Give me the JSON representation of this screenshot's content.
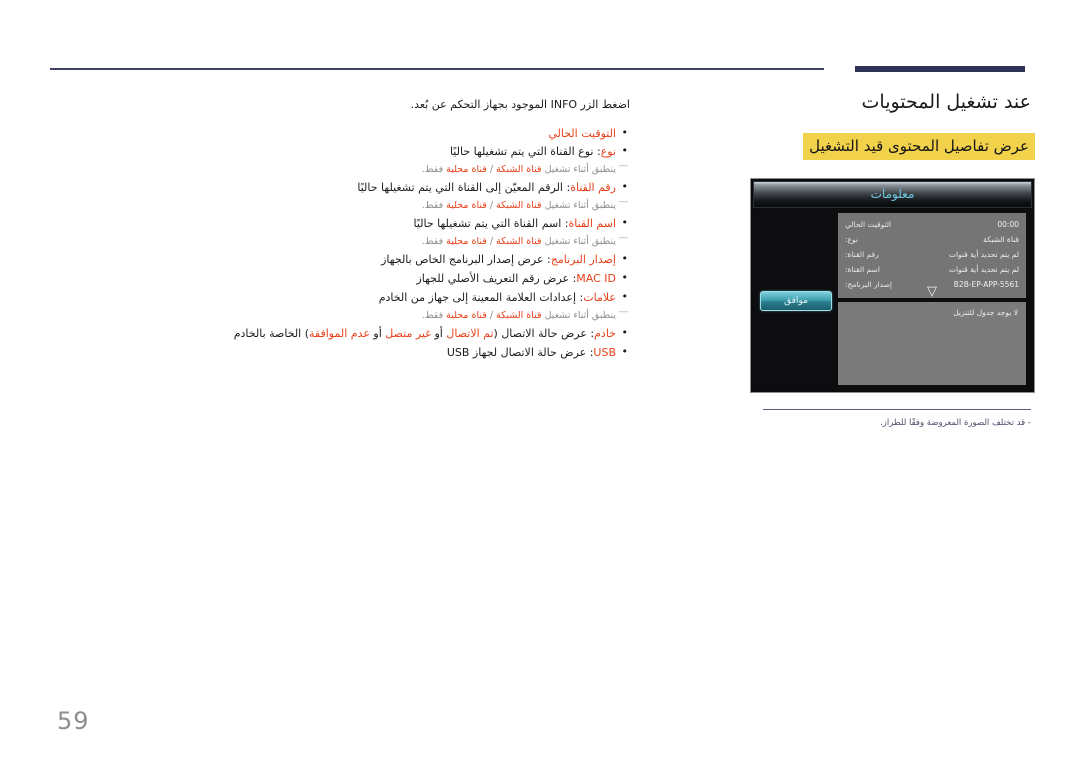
{
  "page": {
    "number": "59",
    "accent_color": "#2e3457",
    "highlight_color": "#f2d14b",
    "keyword_color": "#e8411a"
  },
  "header": {
    "section_title": "عند تشغيل المحتويات",
    "sub_title": "عرض تفاصيل المحتوى قيد التشغيل"
  },
  "body": {
    "intro": "اضغط الزر INFO الموجود بجهاز التحكم عن بُعد.",
    "bullets": [
      {
        "keyword": "التوقيت الحالي",
        "text": "",
        "note": null
      },
      {
        "keyword": "نوع",
        "text": ": نوع القناة التي يتم تشغيلها حاليًا",
        "note": {
          "prefix": "ينطبق أثناء تشغيل ",
          "kw1": "قناة الشبكة",
          "mid": " / ",
          "kw2": "قناة محلية",
          "suffix": " فقط."
        }
      },
      {
        "keyword": "رقم القناة",
        "text": ": الرقم المعيّن إلى القناة التي يتم تشغيلها حاليًا",
        "note": {
          "prefix": "ينطبق أثناء تشغيل ",
          "kw1": "قناة الشبكة",
          "mid": " / ",
          "kw2": "قناة محلية",
          "suffix": " فقط."
        }
      },
      {
        "keyword": "اسم القناة",
        "text": ": اسم القناة التي يتم تشغيلها حاليًا",
        "note": {
          "prefix": "ينطبق أثناء تشغيل ",
          "kw1": "قناة الشبكة",
          "mid": " / ",
          "kw2": "قناة محلية",
          "suffix": " فقط."
        }
      },
      {
        "keyword": "إصدار البرنامج",
        "text": ": عرض إصدار البرنامج الخاص بالجهاز",
        "note": null
      },
      {
        "keyword": "MAC ID",
        "text": ": عرض رقم التعريف الأصلي للجهاز",
        "note": null
      },
      {
        "keyword": "علامات",
        "text": ": إعدادات العلامة المعينة إلى جهاز من الخادم",
        "note": {
          "prefix": "ينطبق أثناء تشغيل ",
          "kw1": "قناة الشبكة",
          "mid": " / ",
          "kw2": "قناة محلية",
          "suffix": " فقط."
        }
      },
      {
        "keyword": "خادم",
        "text_parts": [
          ": عرض حالة الاتصال (",
          "تم الاتصال",
          " أو ",
          "غير متصل",
          " أو ",
          "عدم الموافقة",
          ") الخاصة بالخادم"
        ],
        "note": null
      },
      {
        "keyword": "USB",
        "text": ": عرض حالة الاتصال لجهاز USB",
        "note": null
      }
    ]
  },
  "tv_screen": {
    "title": "معلومات",
    "ok_button": "موافق",
    "info_rows": [
      {
        "label": "التوقيت الحالي",
        "value": "00:00"
      },
      {
        "label": "نوع:",
        "value": "قناة الشبكة"
      },
      {
        "label": "رقم القناة:",
        "value": "لم يتم تحديد أية قنوات"
      },
      {
        "label": "اسم القناة:",
        "value": "لم يتم تحديد أية قنوات"
      },
      {
        "label": "إصدار البرنامج:",
        "value": "B2B-EP-APP-5561"
      }
    ],
    "scroll_icon": "chevron-down",
    "schedule_text": "لا يوجد جدول للتنزيل"
  },
  "footnote": {
    "text": "- قد تختلف الصورة المعروضة وفقًا للطراز."
  }
}
